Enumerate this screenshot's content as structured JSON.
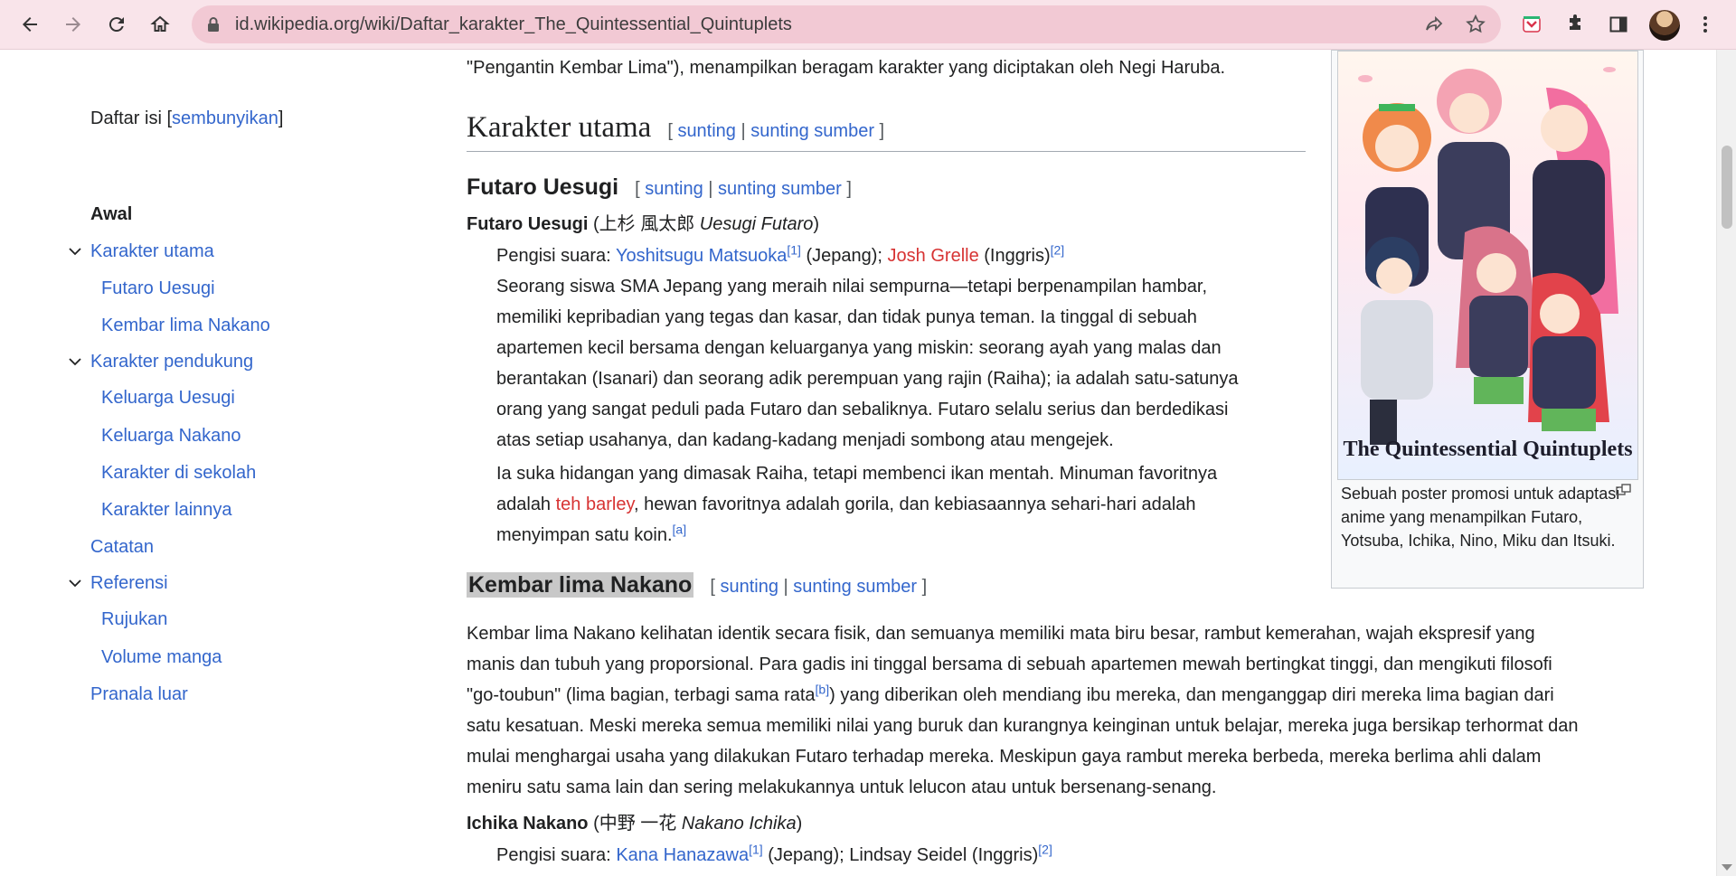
{
  "browser": {
    "url": "id.wikipedia.org/wiki/Daftar_karakter_The_Quintessential_Quintuplets",
    "bg_color": "#f9e4ea"
  },
  "toc": {
    "title": "Daftar isi",
    "hide_link": "sembunyikan",
    "items": [
      {
        "label": "Awal"
      },
      {
        "label": "Karakter utama"
      },
      {
        "label": "Futaro Uesugi"
      },
      {
        "label": "Kembar lima Nakano"
      },
      {
        "label": "Karakter pendukung"
      },
      {
        "label": "Keluarga Uesugi"
      },
      {
        "label": "Keluarga Nakano"
      },
      {
        "label": "Karakter di sekolah"
      },
      {
        "label": "Karakter lainnya"
      },
      {
        "label": "Catatan"
      },
      {
        "label": "Referensi"
      },
      {
        "label": "Rujukan"
      },
      {
        "label": "Volume manga"
      },
      {
        "label": "Pranala luar"
      }
    ]
  },
  "content": {
    "top_line": "\"Pengantin Kembar Lima\"), menampilkan beragam karakter yang diciptakan oleh Negi Haruba.",
    "edit": "sunting",
    "edit_source": "sunting sumber",
    "h2_title": "Karakter utama",
    "h3_futaro": "Futaro Uesugi",
    "futaro": {
      "name": "Futaro Uesugi",
      "kanji": "上杉 風太郎",
      "romaji": "Uesugi Futaro",
      "va_label": "Pengisi suara:",
      "va_jp": "Yoshitsugu Matsuoka",
      "ref1": "[1]",
      "jp": "(Jepang);",
      "va_en": "Josh Grelle",
      "en": "(Inggris)",
      "ref2": "[2]",
      "desc": [
        "Seorang siswa SMA Jepang yang meraih nilai sempurna—tetapi berpenampilan hambar,",
        "memiliki kepribadian yang tegas dan kasar, dan tidak punya teman. Ia tinggal di sebuah",
        "apartemen kecil bersama dengan keluarganya yang miskin: seorang ayah yang malas dan",
        "berantakan (Isanari) dan seorang adik perempuan yang rajin (Raiha); ia adalah satu-satunya",
        "orang yang sangat peduli pada Futaro dan sebaliknya. Futaro selalu serius dan berdedikasi",
        "atas setiap usahanya, dan kadang-kadang menjadi sombong atau mengejek."
      ],
      "desc2_line1": "Ia suka hidangan yang dimasak Raiha, tetapi membenci ikan mentah. Minuman favoritnya",
      "desc2_pre": "adalah",
      "desc2_link": "teh barley",
      "desc2_post": ", hewan favoritnya adalah gorila, dan kebiasaannya sehari-hari adalah",
      "desc2_line3": "menyimpan satu koin.",
      "note_a": "[a]"
    },
    "h3_nakano": "Kembar lima Nakano",
    "nakano_lines": [
      "Kembar lima Nakano kelihatan identik secara fisik, dan semuanya memiliki mata biru besar, rambut kemerahan, wajah ekspresif yang",
      "manis dan tubuh yang proporsional. Para gadis ini tinggal bersama di sebuah apartemen mewah bertingkat tinggi, dan mengikuti filosofi"
    ],
    "nakano_line3_pre": "\"go-toubun\" (lima bagian, terbagi sama rata",
    "note_b": "[b]",
    "nakano_line3_post": ") yang diberikan oleh mendiang ibu mereka, dan menganggap diri mereka lima bagian dari",
    "nakano_lines_rest": [
      "satu kesatuan. Meski mereka semua memiliki nilai yang buruk dan kurangnya keinginan untuk belajar, mereka juga bersikap terhormat dan",
      "mulai menghargai usaha yang dilakukan Futaro terhadap mereka. Meskipun gaya rambut mereka berbeda, mereka berlima ahli dalam",
      "meniru satu sama lain dan sering melakukannya untuk lelucon atau untuk bersenang-senang."
    ],
    "ichika": {
      "name": "Ichika Nakano",
      "kanji": "中野 一花",
      "romaji": "Nakano Ichika",
      "va_label": "Pengisi suara:",
      "va_jp": "Kana Hanazawa",
      "ref1": "[1]",
      "rest": "(Jepang); Lindsay Seidel (Inggris)",
      "ref2": "[2]"
    }
  },
  "infobox": {
    "poster_title": "The Quintessential Quintuplets",
    "caption": "Sebuah poster promosi untuk adaptasi anime yang menampilkan Futaro, Yotsuba, Ichika, Nino, Miku dan Itsuki."
  }
}
